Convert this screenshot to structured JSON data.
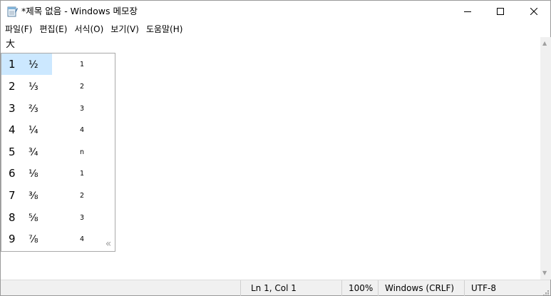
{
  "window": {
    "title": "*제목 없음 - Windows 메모장",
    "app_icon": "notepad-icon",
    "controls": {
      "minimize_icon": "minimize-icon",
      "maximize_icon": "maximize-icon",
      "close_icon": "close-icon"
    }
  },
  "menu": {
    "items": [
      {
        "label": "파일(F)"
      },
      {
        "label": "편집(E)"
      },
      {
        "label": "서식(O)"
      },
      {
        "label": "보기(V)"
      },
      {
        "label": "도움말(H)"
      }
    ]
  },
  "editor": {
    "text": "大"
  },
  "ime": {
    "candidates": [
      {
        "num": "1",
        "text": "½",
        "hint": "1",
        "selected": true
      },
      {
        "num": "2",
        "text": "⅓",
        "hint": "2"
      },
      {
        "num": "3",
        "text": "⅔",
        "hint": "3"
      },
      {
        "num": "4",
        "text": "¼",
        "hint": "4"
      },
      {
        "num": "5",
        "text": "¾",
        "hint": "n"
      },
      {
        "num": "6",
        "text": "⅛",
        "hint": "1"
      },
      {
        "num": "7",
        "text": "⅜",
        "hint": "2"
      },
      {
        "num": "8",
        "text": "⅝",
        "hint": "3"
      },
      {
        "num": "9",
        "text": "⅞",
        "hint": "4"
      }
    ],
    "expand_glyph": "«",
    "highlight_color": "#cce8ff"
  },
  "statusbar": {
    "position": "Ln 1, Col 1",
    "zoom": "100%",
    "line_ending": "Windows (CRLF)",
    "encoding": "UTF-8"
  }
}
